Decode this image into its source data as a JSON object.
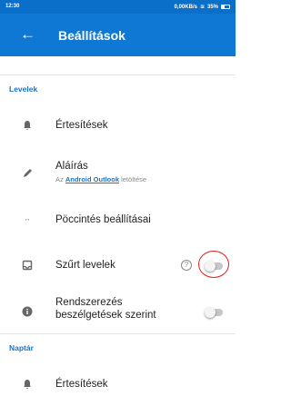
{
  "statusbar": {
    "time": "12:30",
    "info": "0,00KB/s",
    "battery": "35%"
  },
  "appbar": {
    "back_icon": "←",
    "title": "Beállítások"
  },
  "sections": {
    "mail": "Levelek",
    "calendar": "Naptár"
  },
  "rows": {
    "notifications": {
      "label": "Értesítések",
      "icon": "bell-icon"
    },
    "signature": {
      "label": "Aláírás",
      "sub_prefix": "Az ",
      "sub_link": "Android Outlook",
      "sub_suffix": " letöltése",
      "icon": "pen-icon"
    },
    "swipe": {
      "label": "Pöccintés beállításai",
      "icon": "swipe-icon"
    },
    "filtered": {
      "label": "Szűrt levelek",
      "help": "?",
      "toggle": "off",
      "icon": "inbox-icon"
    },
    "threads": {
      "label_line1": "Rendszerezés",
      "label_line2": "beszélgetések szerint",
      "toggle": "off",
      "icon": "info-icon"
    },
    "cal_notifications": {
      "label": "Értesítések",
      "icon": "bell-icon"
    }
  },
  "colors": {
    "appbar": "#0f78d4",
    "accent": "#1a73c8",
    "highlight_circle": "#e02020"
  }
}
